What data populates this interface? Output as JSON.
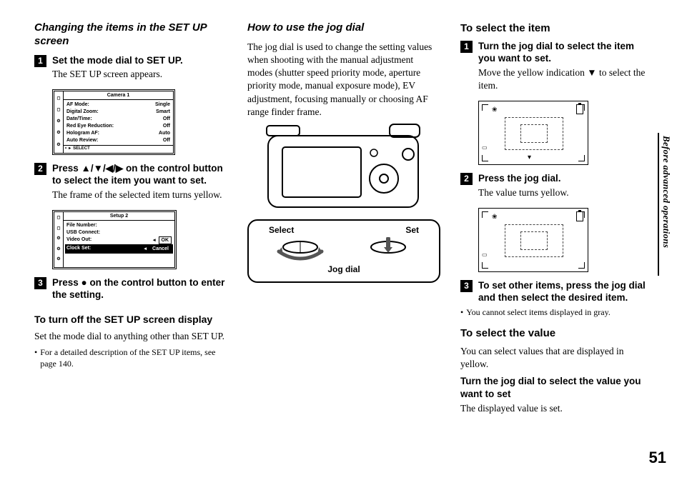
{
  "page_number": "51",
  "sidebar_label": "Before advanced operations",
  "col1": {
    "heading": "Changing the items in the SET UP screen",
    "step1_bold": "Set the mode dial to SET UP.",
    "step1_body": "The SET UP screen appears.",
    "screen1": {
      "title": "Camera 1",
      "rows": [
        {
          "label": "AF Mode:",
          "value": "Single"
        },
        {
          "label": "Digital Zoom:",
          "value": "Smart"
        },
        {
          "label": "Date/Time:",
          "value": "Off"
        },
        {
          "label": "Red Eye Reduction:",
          "value": "Off"
        },
        {
          "label": "Hologram AF:",
          "value": "Auto"
        },
        {
          "label": "Auto Review:",
          "value": "Off"
        }
      ],
      "footer": "SELECT"
    },
    "step2_bold": "Press ▲/▼/◀/▶ on the control button to select the item you want to set.",
    "step2_body": "The frame of the selected item turns yellow.",
    "screen2": {
      "title": "Setup 2",
      "rows": [
        {
          "label": "File Number:",
          "value": ""
        },
        {
          "label": "USB Connect:",
          "value": ""
        },
        {
          "label": "Video Out:",
          "value": "OK",
          "ok": true
        },
        {
          "label": "Clock Set:",
          "value": "Cancel",
          "sel": true
        }
      ]
    },
    "step3_bold": "Press ● on the control button to enter the setting.",
    "sub1_head": "To turn off the SET UP screen display",
    "sub1_body": "Set the mode dial to anything other than SET UP.",
    "note1": "For a detailed description of the SET UP items, see page 140."
  },
  "col2": {
    "heading": "How to use the jog dial",
    "body": "The jog dial is used to change the setting values when shooting with the manual adjustment modes (shutter speed priority mode, aperture priority mode, manual exposure mode), EV adjustment, focusing manually or choosing AF range finder frame.",
    "jog": {
      "select": "Select",
      "set": "Set",
      "caption": "Jog dial"
    }
  },
  "col3": {
    "head1": "To select the item",
    "step1_bold": "Turn the jog dial to select the item you want to set.",
    "step1_body": "Move the yellow indication ▼ to select the item.",
    "step2_bold": "Press the jog dial.",
    "step2_body": "The value turns yellow.",
    "step3_bold": "To set other items, press the jog dial and then select the desired item.",
    "note1": "You cannot select items displayed in gray.",
    "head2": "To select the value",
    "head2_body": "You can select values that are displayed in yellow.",
    "sub_bold": "Turn the jog dial to select the value you want to set",
    "sub_body": "The displayed value is set."
  }
}
